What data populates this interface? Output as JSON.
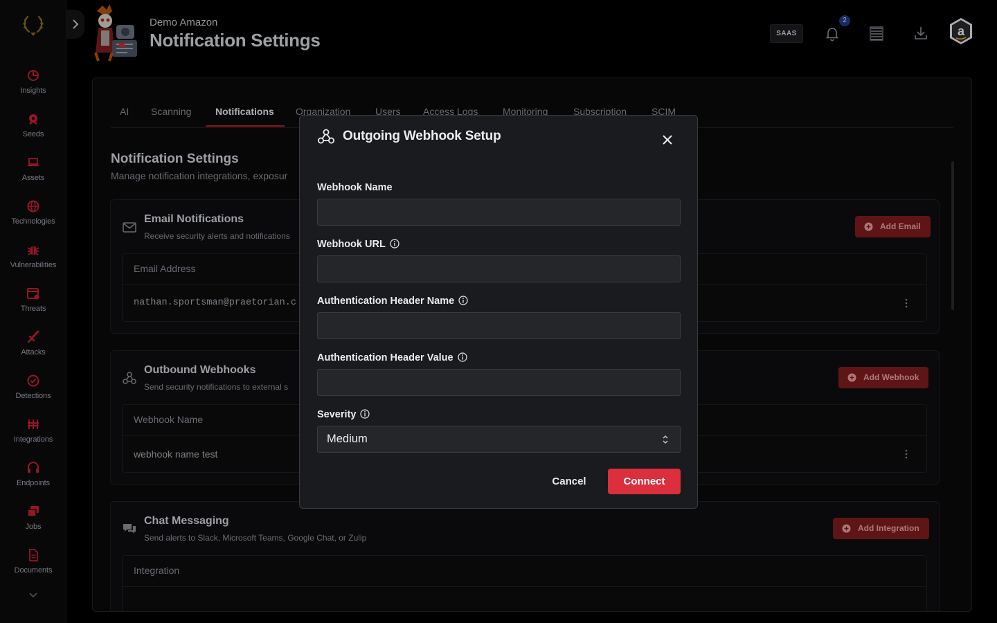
{
  "sidebar": {
    "items": [
      {
        "label": "Insights",
        "icon": "insights-icon"
      },
      {
        "label": "Seeds",
        "icon": "seeds-icon"
      },
      {
        "label": "Assets",
        "icon": "laptop-icon"
      },
      {
        "label": "Technologies",
        "icon": "globe-icon"
      },
      {
        "label": "Vulnerabilities",
        "icon": "bug-icon"
      },
      {
        "label": "Threats",
        "icon": "threat-calendar-icon"
      },
      {
        "label": "Attacks",
        "icon": "sword-icon"
      },
      {
        "label": "Detections",
        "icon": "check-circle-icon"
      },
      {
        "label": "Integrations",
        "icon": "integrations-icon"
      },
      {
        "label": "Endpoints",
        "icon": "headset-icon"
      },
      {
        "label": "Jobs",
        "icon": "stack-icon"
      },
      {
        "label": "Documents",
        "icon": "document-icon"
      }
    ]
  },
  "header": {
    "subtitle": "Demo Amazon",
    "title": "Notification Settings",
    "saas_badge": "SAAS",
    "notification_count": "2",
    "avatar_letter": "a"
  },
  "tabs": [
    "AI",
    "Scanning",
    "Notifications",
    "Organization",
    "Users",
    "Access Logs",
    "Monitoring",
    "Subscription",
    "SCIM"
  ],
  "active_tab": "Notifications",
  "section": {
    "title": "Notification Settings",
    "subtitle": "Manage notification integrations, exposur"
  },
  "email_card": {
    "title": "Email Notifications",
    "description": "Receive security alerts and notifications",
    "button": "Add Email",
    "column": "Email Address",
    "rows": [
      "nathan.sportsman@praetorian.c"
    ]
  },
  "webhook_card": {
    "title": "Outbound Webhooks",
    "description": "Send security notifications to external s",
    "button": "Add Webhook",
    "column": "Webhook Name",
    "rows": [
      "webhook name test"
    ]
  },
  "chat_card": {
    "title": "Chat Messaging",
    "description": "Send alerts to Slack, Microsoft Teams, Google Chat, or Zulip",
    "button": "Add Integration",
    "column": "Integration"
  },
  "modal": {
    "title": "Outgoing Webhook Setup",
    "fields": {
      "name_label": "Webhook Name",
      "name_value": "",
      "url_label": "Webhook URL",
      "url_value": "",
      "header_name_label": "Authentication Header Name",
      "header_name_value": "",
      "header_value_label": "Authentication Header Value",
      "header_value_value": ""
    },
    "severity_label": "Severity",
    "severity_value": "Medium",
    "cancel": "Cancel",
    "connect": "Connect"
  },
  "colors": {
    "accent": "#dc2f3d",
    "accent_dark": "#7f1d1d",
    "sidebar_icon": "#c81e32",
    "background": "#000000",
    "modal_bg": "#1a1b1e"
  }
}
